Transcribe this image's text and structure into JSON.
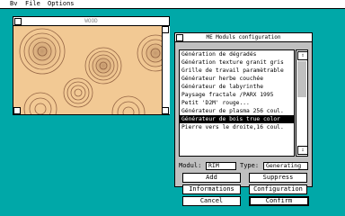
{
  "menubar": {
    "items": [
      "Bv",
      "File",
      "Options"
    ]
  },
  "canvas_window": {
    "title": "WOOD"
  },
  "config_window": {
    "title": "ME Moduls configuration",
    "modules": [
      "Génération de dégradés",
      "Génération texture granit gris",
      "Grille de travail paramètrable",
      "Générateur herbe couchée",
      "Générateur de labyrinthe",
      "Paysage fractale /PARX 1995",
      "Petit 'D2M' rouge...",
      "Générateur de plasma 256 coul.",
      "Générateur de bois true color",
      "Pierre vers le droite,16 coul."
    ],
    "selected_index": 8,
    "scroll_up_glyph": "⇧",
    "scroll_down_glyph": "⇩",
    "modul_label": "Modul:",
    "modul_value": "RIM",
    "type_label": "Type:",
    "type_value": "Generating",
    "buttons": {
      "add": "Add",
      "suppress": "Suppress",
      "informations": "Informations",
      "configuration": "Configuration",
      "cancel": "Cancel",
      "confirm": "Confirm"
    }
  }
}
